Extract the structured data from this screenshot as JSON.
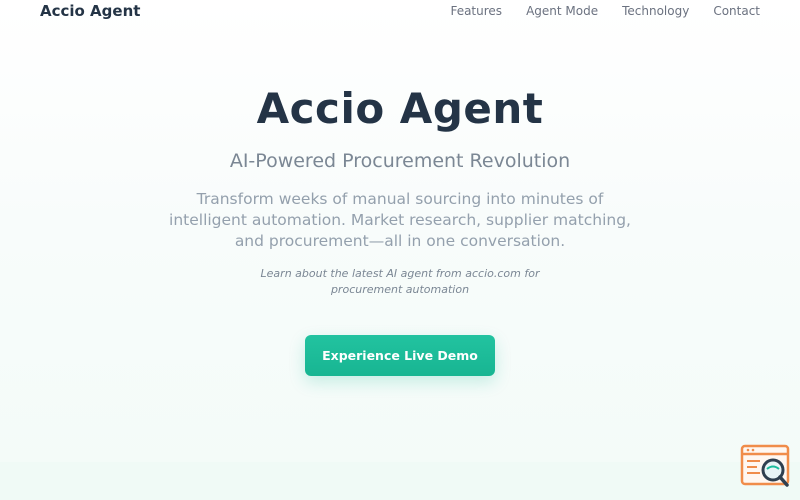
{
  "header": {
    "brand": "Accio Agent",
    "nav": [
      {
        "label": "Features"
      },
      {
        "label": "Agent Mode"
      },
      {
        "label": "Technology"
      },
      {
        "label": "Contact"
      }
    ]
  },
  "hero": {
    "title": "Accio Agent",
    "subtitle": "AI-Powered Procurement Revolution",
    "description": "Transform weeks of manual sourcing into minutes of intelligent automation. Market research, supplier matching, and procurement—all in one conversation.",
    "note": "Learn about the latest AI agent from accio.com for procurement automation",
    "cta_label": "Experience Live Demo"
  },
  "widget": {
    "icon": "search-document-icon"
  },
  "colors": {
    "text_dark": "#243446",
    "text_muted": "#7b8794",
    "accent": "#1abc9c",
    "widget_orange": "#f08c4a"
  }
}
